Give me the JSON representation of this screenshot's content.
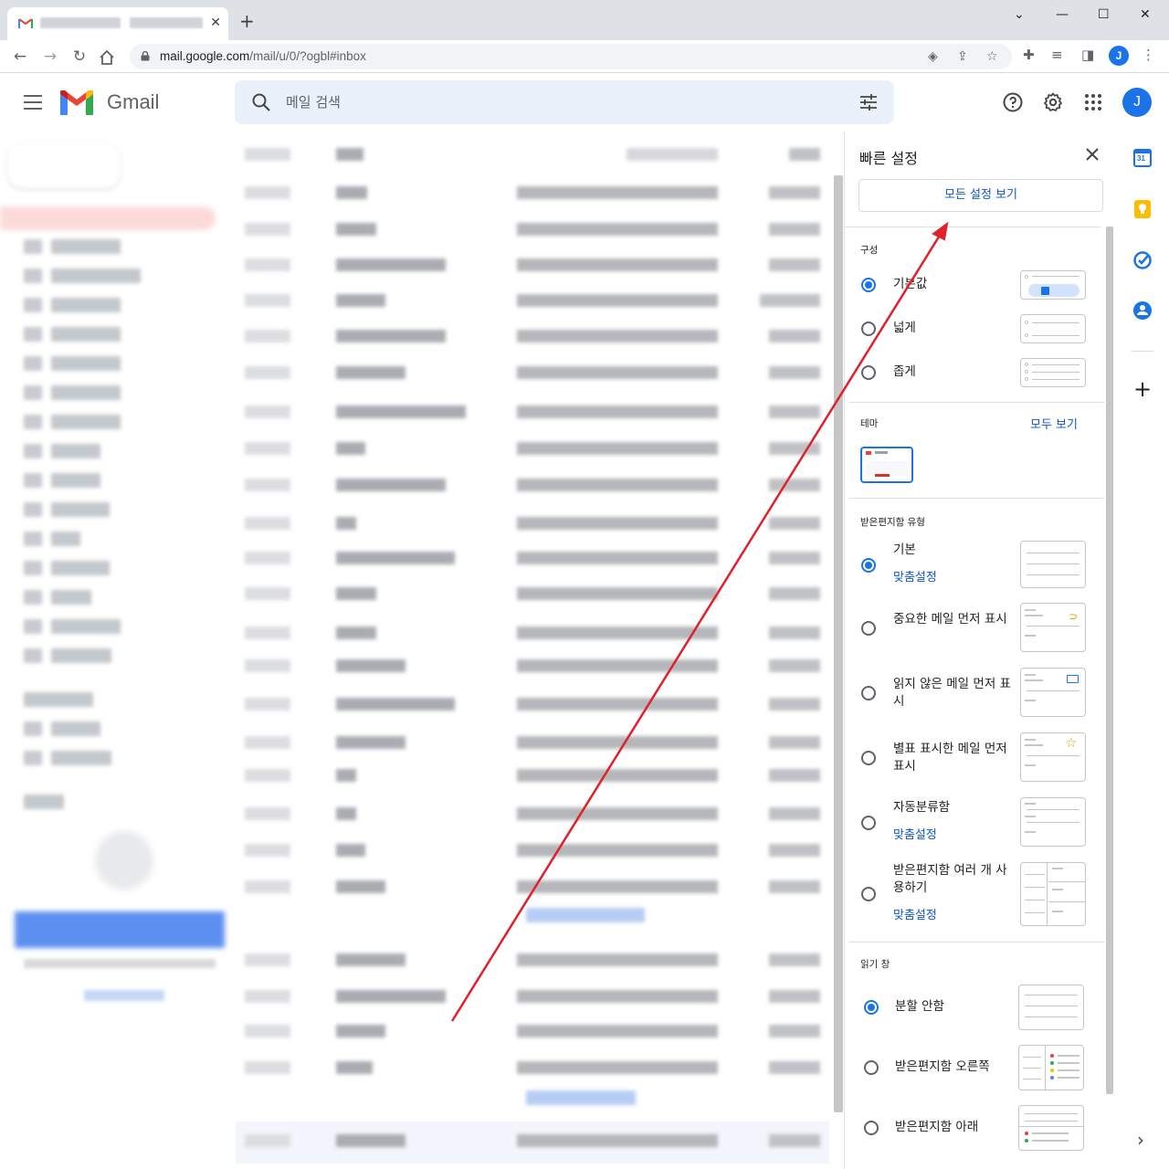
{
  "browser": {
    "tab_close": "✕",
    "new_tab": "+",
    "window_controls": {
      "minimize": "⌄",
      "restore": "—",
      "maximize": "☐",
      "close": "✕"
    },
    "url_host": "mail.google.com",
    "url_path": "/mail/u/0/?ogbl#inbox",
    "profile_initial": "J"
  },
  "header": {
    "product": "Gmail",
    "search_placeholder": "메일 검색",
    "avatar_initial": "J"
  },
  "quick_settings": {
    "title": "빠른 설정",
    "see_all_button": "모든 설정 보기",
    "density": {
      "heading": "구성",
      "options": [
        {
          "label": "기본값",
          "selected": true
        },
        {
          "label": "넓게",
          "selected": false
        },
        {
          "label": "좁게",
          "selected": false
        }
      ]
    },
    "theme": {
      "heading": "테마",
      "view_all": "모두 보기"
    },
    "inbox_type": {
      "heading": "받은편지함 유형",
      "options": [
        {
          "label": "기본",
          "customize": "맞춤설정",
          "selected": true
        },
        {
          "label": "중요한 메일 먼저 표시",
          "selected": false
        },
        {
          "label": "읽지 않은 메일 먼저 표시",
          "selected": false
        },
        {
          "label": "별표 표시한 메일 먼저 표시",
          "selected": false
        },
        {
          "label": "자동분류함",
          "customize": "맞춤설정",
          "selected": false
        },
        {
          "label": "받은편지함 여러 개 사용하기",
          "customize": "맞춤설정",
          "selected": false
        }
      ]
    },
    "reading_pane": {
      "heading": "읽기 창",
      "options": [
        {
          "label": "분할 안함",
          "selected": true
        },
        {
          "label": "받은편지함 오른쪽",
          "selected": false
        },
        {
          "label": "받은편지함 아래",
          "selected": false
        }
      ]
    }
  },
  "rail": {
    "calendar_day": "31",
    "add": "+",
    "expand": "›"
  },
  "colors": {
    "accent": "#1a73e8",
    "link": "#0b57d0",
    "annotation_arrow": "#e0202a"
  }
}
